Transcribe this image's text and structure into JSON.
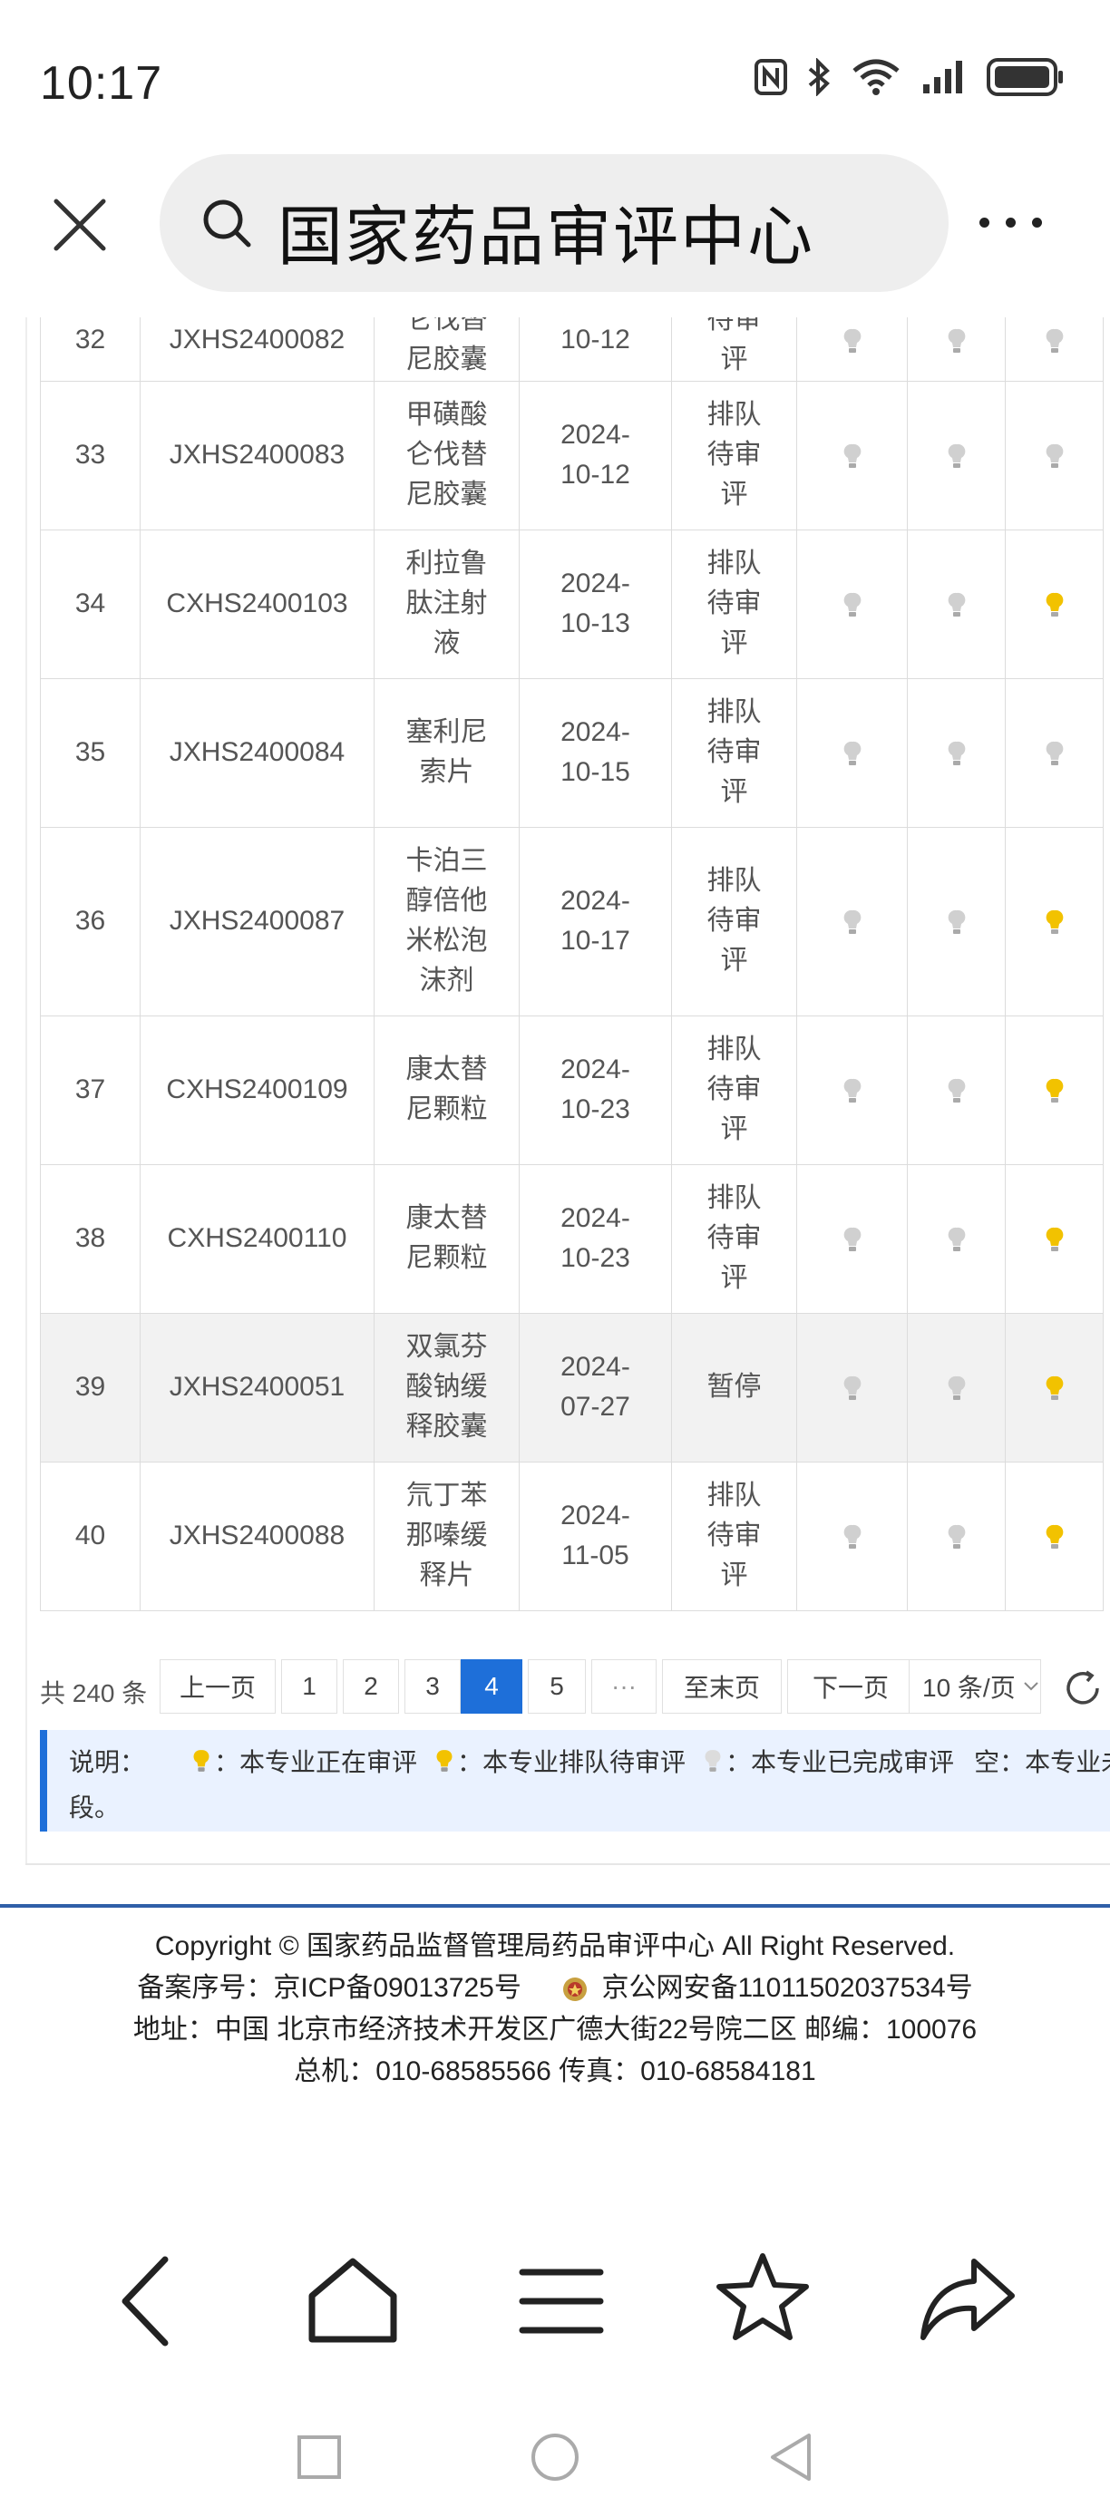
{
  "status_bar": {
    "time": "10:17"
  },
  "search": {
    "query": "国家药品审评中心"
  },
  "table": {
    "rows": [
      {
        "no": "32",
        "code": "JXHS2400082",
        "name": [
          "仑伐替",
          "尼胶囊"
        ],
        "date": [
          "",
          "10-12"
        ],
        "status": [
          "待审",
          "评"
        ],
        "lights": [
          "off",
          "off",
          "off"
        ]
      },
      {
        "no": "33",
        "code": "JXHS2400083",
        "name": [
          "甲磺酸",
          "仑伐替",
          "尼胶囊"
        ],
        "date": [
          "2024-",
          "10-12"
        ],
        "status": [
          "排队",
          "待审",
          "评"
        ],
        "lights": [
          "off",
          "off",
          "off"
        ]
      },
      {
        "no": "34",
        "code": "CXHS2400103",
        "name": [
          "利拉鲁",
          "肽注射",
          "液"
        ],
        "date": [
          "2024-",
          "10-13"
        ],
        "status": [
          "排队",
          "待审",
          "评"
        ],
        "lights": [
          "off",
          "off",
          "on"
        ]
      },
      {
        "no": "35",
        "code": "JXHS2400084",
        "name": [
          "塞利尼",
          "索片"
        ],
        "date": [
          "2024-",
          "10-15"
        ],
        "status": [
          "排队",
          "待审",
          "评"
        ],
        "lights": [
          "off",
          "off",
          "off"
        ]
      },
      {
        "no": "36",
        "code": "JXHS2400087",
        "name": [
          "卡泊三",
          "醇倍他",
          "米松泡",
          "沫剂"
        ],
        "date": [
          "2024-",
          "10-17"
        ],
        "status": [
          "排队",
          "待审",
          "评"
        ],
        "lights": [
          "off",
          "off",
          "on"
        ]
      },
      {
        "no": "37",
        "code": "CXHS2400109",
        "name": [
          "康太替",
          "尼颗粒"
        ],
        "date": [
          "2024-",
          "10-23"
        ],
        "status": [
          "排队",
          "待审",
          "评"
        ],
        "lights": [
          "off",
          "off",
          "on"
        ]
      },
      {
        "no": "38",
        "code": "CXHS2400110",
        "name": [
          "康太替",
          "尼颗粒"
        ],
        "date": [
          "2024-",
          "10-23"
        ],
        "status": [
          "排队",
          "待审",
          "评"
        ],
        "lights": [
          "off",
          "off",
          "on"
        ]
      },
      {
        "no": "39",
        "code": "JXHS2400051",
        "name": [
          "双氯芬",
          "酸钠缓",
          "释胶囊"
        ],
        "date": [
          "2024-",
          "07-27"
        ],
        "status": [
          "暂停"
        ],
        "lights": [
          "off",
          "off",
          "on"
        ]
      },
      {
        "no": "40",
        "code": "JXHS2400088",
        "name": [
          "氘丁苯",
          "那嗪缓",
          "释片"
        ],
        "date": [
          "2024-",
          "11-05"
        ],
        "status": [
          "排队",
          "待审",
          "评"
        ],
        "lights": [
          "off",
          "off",
          "on"
        ]
      }
    ]
  },
  "pagination": {
    "total": "共 240 条",
    "prev": "上一页",
    "pages": [
      "1",
      "2",
      "3",
      "4",
      "5"
    ],
    "current": "4",
    "ellipsis": "···",
    "last": "至末页",
    "next": "下一页",
    "page_size": "10 条/页"
  },
  "legend": {
    "title": "说明：",
    "reviewing": "：本专业正在审评",
    "queued": "：本专业排队待审评",
    "done": "：本专业已完成审评",
    "empty": "空：本专业未启动",
    "tail": "段。"
  },
  "footer": {
    "copyright": "Copyright © 国家药品监督管理局药品审评中心    All Right Reserved.",
    "icp": "备案序号：京ICP备09013725号",
    "police": "京公网安备11011502037534号",
    "address": "地址：中国 北京市经济技术开发区广德大街22号院二区     邮编：100076",
    "phone": "总机：010-68585566     传真：010-68584181"
  },
  "colors": {
    "accent": "#1e6fd9",
    "bulb_on": "#f2c200",
    "bulb_off": "#d0d0d0",
    "footer_line": "#2f5fa8",
    "legend_bg": "#eaf2ff"
  }
}
